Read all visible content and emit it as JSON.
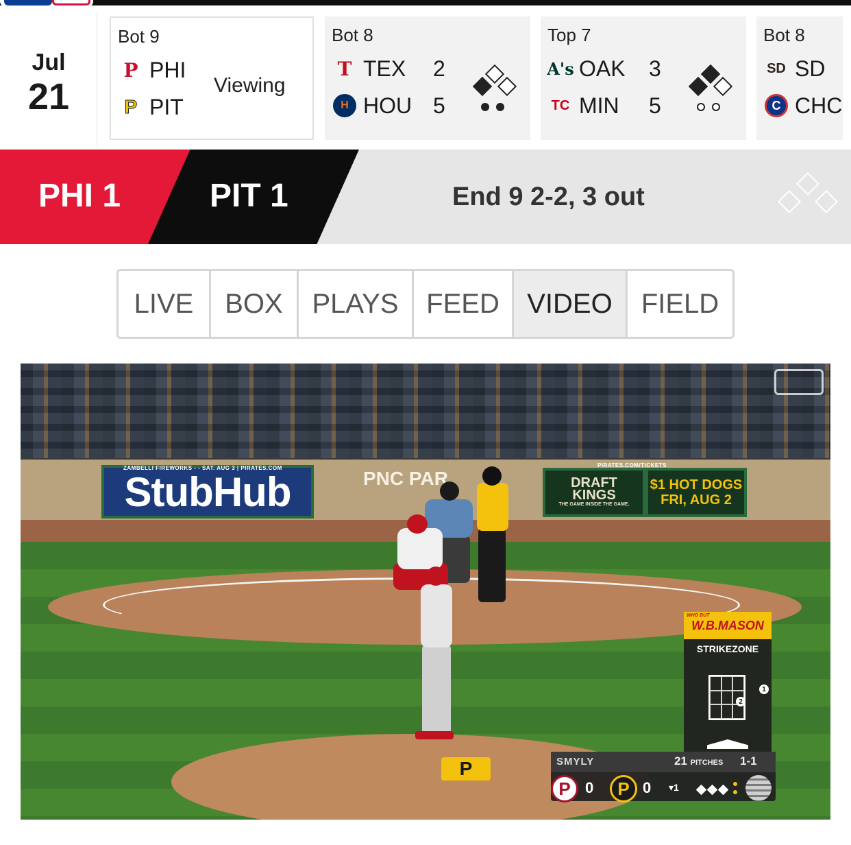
{
  "date": {
    "month": "Jul",
    "day": "21"
  },
  "games": [
    {
      "inning": "Bot 9",
      "away": {
        "abbr": "PHI",
        "logo": "P"
      },
      "home": {
        "abbr": "PIT",
        "logo": "P"
      },
      "status": "Viewing",
      "active": true
    },
    {
      "inning": "Bot 8",
      "away": {
        "abbr": "TEX",
        "logo": "T",
        "score": "2"
      },
      "home": {
        "abbr": "HOU",
        "logo": "H",
        "score": "5"
      }
    },
    {
      "inning": "Top 7",
      "away": {
        "abbr": "OAK",
        "logo": "A's",
        "score": "3"
      },
      "home": {
        "abbr": "MIN",
        "logo": "TC",
        "score": "5"
      }
    },
    {
      "inning": "Bot 8",
      "away": {
        "abbr": "SD",
        "logo": "SD"
      },
      "home": {
        "abbr": "CHC",
        "logo": "C"
      }
    }
  ],
  "banner": {
    "away": "PHI 1",
    "home": "PIT 1",
    "status": "End 9  2-2, 3 out"
  },
  "tabs": [
    {
      "label": "LIVE"
    },
    {
      "label": "BOX"
    },
    {
      "label": "PLAYS"
    },
    {
      "label": "FEED"
    },
    {
      "label": "VIDEO",
      "selected": true
    },
    {
      "label": "FIELD"
    }
  ],
  "video": {
    "ads": {
      "stubhub": "StubHub",
      "stubhub_sub": "ZAMBELLI FIREWORKS - - SAT. AUG 3 | PIRATES.COM",
      "pnc": "PNC PAR",
      "draftkings_line1": "DRAFT",
      "draftkings_line2": "KINGS",
      "draftkings_sub": "THE GAME INSIDE THE GAME.",
      "hotdogs_line1": "$1 HOT DOGS",
      "hotdogs_line2": "FRI, AUG 2",
      "pirates_url": "PIRATES.COM/TICKETS",
      "mound_logo": "P"
    },
    "strikezone": {
      "sponsor": "W.B.MASON",
      "sponsor_tag": "WHO BUT",
      "title": "STRIKEZONE",
      "pitch1": "1",
      "pitch2": "2"
    },
    "scorebug": {
      "pitcher": "SMYLY",
      "pitches": "21",
      "pitches_label": "PITCHES",
      "count": "1-1",
      "away_logo": "P",
      "away_runs": "0",
      "home_logo": "P",
      "home_runs": "0",
      "inning": "▾1"
    }
  }
}
